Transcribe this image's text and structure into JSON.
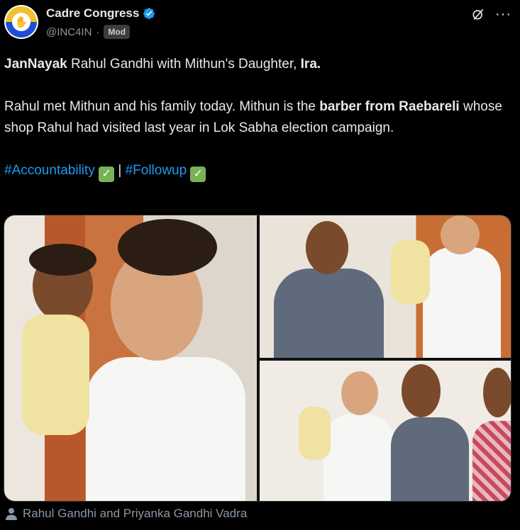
{
  "author": {
    "display_name": "Cadre Congress",
    "handle": "@INC4IN",
    "separator": "·",
    "badge": "Mod",
    "avatar_icon": "congress-hand-logo",
    "verified_icon": "verified-badge-icon",
    "accent": "#1d9bf0"
  },
  "header_icons": [
    "grok-icon",
    "more-icon"
  ],
  "more_label": "···",
  "post": {
    "line1": {
      "bold1": "JanNayak",
      "mid": " Rahul Gandhi with Mithun's Daughter, ",
      "bold2": "Ira."
    },
    "line2": {
      "pre": "Rahul met Mithun and his family today. Mithun is the ",
      "bold": "barber from Raebareli",
      "post": " whose shop Rahul had visited last year in Lok Sabha election campaign."
    },
    "hashtags": {
      "tag1": "#Accountability",
      "sep": " | ",
      "tag2": "#Followup",
      "check": "✓"
    }
  },
  "media": {
    "images": [
      "photo-1",
      "photo-2",
      "photo-3"
    ]
  },
  "tagged_people": {
    "icon": "person-icon",
    "text": "Rahul Gandhi and Priyanka Gandhi Vadra"
  }
}
